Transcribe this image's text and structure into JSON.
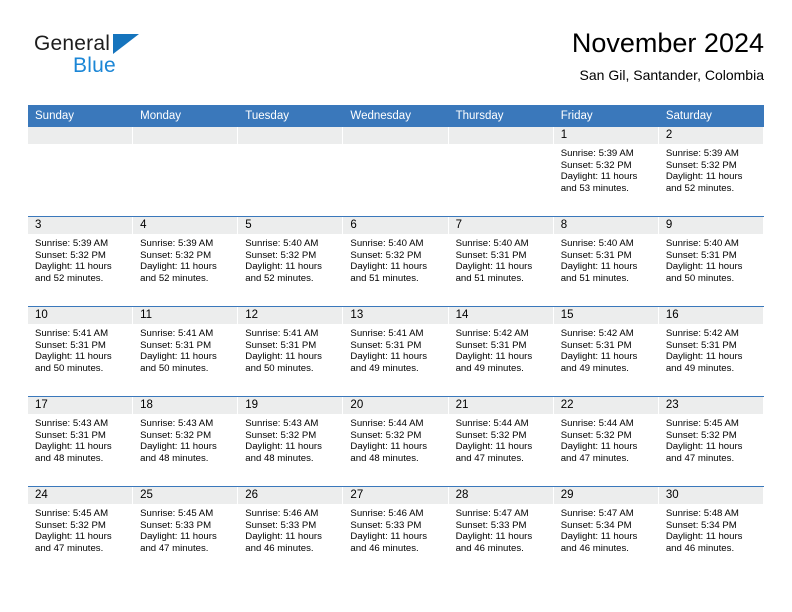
{
  "brand": {
    "name_top": "General",
    "name_bottom": "Blue",
    "triangle_color": "#1574bd",
    "blue_text_color": "#1b86d6"
  },
  "header": {
    "title": "November 2024",
    "subtitle": "San Gil, Santander, Colombia"
  },
  "theme": {
    "header_band": "#3a78bb",
    "daynum_band": "#eceded",
    "row_rule": "#3a78bb"
  },
  "weekdays": [
    "Sunday",
    "Monday",
    "Tuesday",
    "Wednesday",
    "Thursday",
    "Friday",
    "Saturday"
  ],
  "weeks": [
    [
      {
        "day": "",
        "sunrise": "",
        "sunset": "",
        "daylight_line1": "",
        "daylight_line2": ""
      },
      {
        "day": "",
        "sunrise": "",
        "sunset": "",
        "daylight_line1": "",
        "daylight_line2": ""
      },
      {
        "day": "",
        "sunrise": "",
        "sunset": "",
        "daylight_line1": "",
        "daylight_line2": ""
      },
      {
        "day": "",
        "sunrise": "",
        "sunset": "",
        "daylight_line1": "",
        "daylight_line2": ""
      },
      {
        "day": "",
        "sunrise": "",
        "sunset": "",
        "daylight_line1": "",
        "daylight_line2": ""
      },
      {
        "day": "1",
        "sunrise": "Sunrise: 5:39 AM",
        "sunset": "Sunset: 5:32 PM",
        "daylight_line1": "Daylight: 11 hours",
        "daylight_line2": "and 53 minutes."
      },
      {
        "day": "2",
        "sunrise": "Sunrise: 5:39 AM",
        "sunset": "Sunset: 5:32 PM",
        "daylight_line1": "Daylight: 11 hours",
        "daylight_line2": "and 52 minutes."
      }
    ],
    [
      {
        "day": "3",
        "sunrise": "Sunrise: 5:39 AM",
        "sunset": "Sunset: 5:32 PM",
        "daylight_line1": "Daylight: 11 hours",
        "daylight_line2": "and 52 minutes."
      },
      {
        "day": "4",
        "sunrise": "Sunrise: 5:39 AM",
        "sunset": "Sunset: 5:32 PM",
        "daylight_line1": "Daylight: 11 hours",
        "daylight_line2": "and 52 minutes."
      },
      {
        "day": "5",
        "sunrise": "Sunrise: 5:40 AM",
        "sunset": "Sunset: 5:32 PM",
        "daylight_line1": "Daylight: 11 hours",
        "daylight_line2": "and 52 minutes."
      },
      {
        "day": "6",
        "sunrise": "Sunrise: 5:40 AM",
        "sunset": "Sunset: 5:32 PM",
        "daylight_line1": "Daylight: 11 hours",
        "daylight_line2": "and 51 minutes."
      },
      {
        "day": "7",
        "sunrise": "Sunrise: 5:40 AM",
        "sunset": "Sunset: 5:31 PM",
        "daylight_line1": "Daylight: 11 hours",
        "daylight_line2": "and 51 minutes."
      },
      {
        "day": "8",
        "sunrise": "Sunrise: 5:40 AM",
        "sunset": "Sunset: 5:31 PM",
        "daylight_line1": "Daylight: 11 hours",
        "daylight_line2": "and 51 minutes."
      },
      {
        "day": "9",
        "sunrise": "Sunrise: 5:40 AM",
        "sunset": "Sunset: 5:31 PM",
        "daylight_line1": "Daylight: 11 hours",
        "daylight_line2": "and 50 minutes."
      }
    ],
    [
      {
        "day": "10",
        "sunrise": "Sunrise: 5:41 AM",
        "sunset": "Sunset: 5:31 PM",
        "daylight_line1": "Daylight: 11 hours",
        "daylight_line2": "and 50 minutes."
      },
      {
        "day": "11",
        "sunrise": "Sunrise: 5:41 AM",
        "sunset": "Sunset: 5:31 PM",
        "daylight_line1": "Daylight: 11 hours",
        "daylight_line2": "and 50 minutes."
      },
      {
        "day": "12",
        "sunrise": "Sunrise: 5:41 AM",
        "sunset": "Sunset: 5:31 PM",
        "daylight_line1": "Daylight: 11 hours",
        "daylight_line2": "and 50 minutes."
      },
      {
        "day": "13",
        "sunrise": "Sunrise: 5:41 AM",
        "sunset": "Sunset: 5:31 PM",
        "daylight_line1": "Daylight: 11 hours",
        "daylight_line2": "and 49 minutes."
      },
      {
        "day": "14",
        "sunrise": "Sunrise: 5:42 AM",
        "sunset": "Sunset: 5:31 PM",
        "daylight_line1": "Daylight: 11 hours",
        "daylight_line2": "and 49 minutes."
      },
      {
        "day": "15",
        "sunrise": "Sunrise: 5:42 AM",
        "sunset": "Sunset: 5:31 PM",
        "daylight_line1": "Daylight: 11 hours",
        "daylight_line2": "and 49 minutes."
      },
      {
        "day": "16",
        "sunrise": "Sunrise: 5:42 AM",
        "sunset": "Sunset: 5:31 PM",
        "daylight_line1": "Daylight: 11 hours",
        "daylight_line2": "and 49 minutes."
      }
    ],
    [
      {
        "day": "17",
        "sunrise": "Sunrise: 5:43 AM",
        "sunset": "Sunset: 5:31 PM",
        "daylight_line1": "Daylight: 11 hours",
        "daylight_line2": "and 48 minutes."
      },
      {
        "day": "18",
        "sunrise": "Sunrise: 5:43 AM",
        "sunset": "Sunset: 5:32 PM",
        "daylight_line1": "Daylight: 11 hours",
        "daylight_line2": "and 48 minutes."
      },
      {
        "day": "19",
        "sunrise": "Sunrise: 5:43 AM",
        "sunset": "Sunset: 5:32 PM",
        "daylight_line1": "Daylight: 11 hours",
        "daylight_line2": "and 48 minutes."
      },
      {
        "day": "20",
        "sunrise": "Sunrise: 5:44 AM",
        "sunset": "Sunset: 5:32 PM",
        "daylight_line1": "Daylight: 11 hours",
        "daylight_line2": "and 48 minutes."
      },
      {
        "day": "21",
        "sunrise": "Sunrise: 5:44 AM",
        "sunset": "Sunset: 5:32 PM",
        "daylight_line1": "Daylight: 11 hours",
        "daylight_line2": "and 47 minutes."
      },
      {
        "day": "22",
        "sunrise": "Sunrise: 5:44 AM",
        "sunset": "Sunset: 5:32 PM",
        "daylight_line1": "Daylight: 11 hours",
        "daylight_line2": "and 47 minutes."
      },
      {
        "day": "23",
        "sunrise": "Sunrise: 5:45 AM",
        "sunset": "Sunset: 5:32 PM",
        "daylight_line1": "Daylight: 11 hours",
        "daylight_line2": "and 47 minutes."
      }
    ],
    [
      {
        "day": "24",
        "sunrise": "Sunrise: 5:45 AM",
        "sunset": "Sunset: 5:32 PM",
        "daylight_line1": "Daylight: 11 hours",
        "daylight_line2": "and 47 minutes."
      },
      {
        "day": "25",
        "sunrise": "Sunrise: 5:45 AM",
        "sunset": "Sunset: 5:33 PM",
        "daylight_line1": "Daylight: 11 hours",
        "daylight_line2": "and 47 minutes."
      },
      {
        "day": "26",
        "sunrise": "Sunrise: 5:46 AM",
        "sunset": "Sunset: 5:33 PM",
        "daylight_line1": "Daylight: 11 hours",
        "daylight_line2": "and 46 minutes."
      },
      {
        "day": "27",
        "sunrise": "Sunrise: 5:46 AM",
        "sunset": "Sunset: 5:33 PM",
        "daylight_line1": "Daylight: 11 hours",
        "daylight_line2": "and 46 minutes."
      },
      {
        "day": "28",
        "sunrise": "Sunrise: 5:47 AM",
        "sunset": "Sunset: 5:33 PM",
        "daylight_line1": "Daylight: 11 hours",
        "daylight_line2": "and 46 minutes."
      },
      {
        "day": "29",
        "sunrise": "Sunrise: 5:47 AM",
        "sunset": "Sunset: 5:34 PM",
        "daylight_line1": "Daylight: 11 hours",
        "daylight_line2": "and 46 minutes."
      },
      {
        "day": "30",
        "sunrise": "Sunrise: 5:48 AM",
        "sunset": "Sunset: 5:34 PM",
        "daylight_line1": "Daylight: 11 hours",
        "daylight_line2": "and 46 minutes."
      }
    ]
  ]
}
